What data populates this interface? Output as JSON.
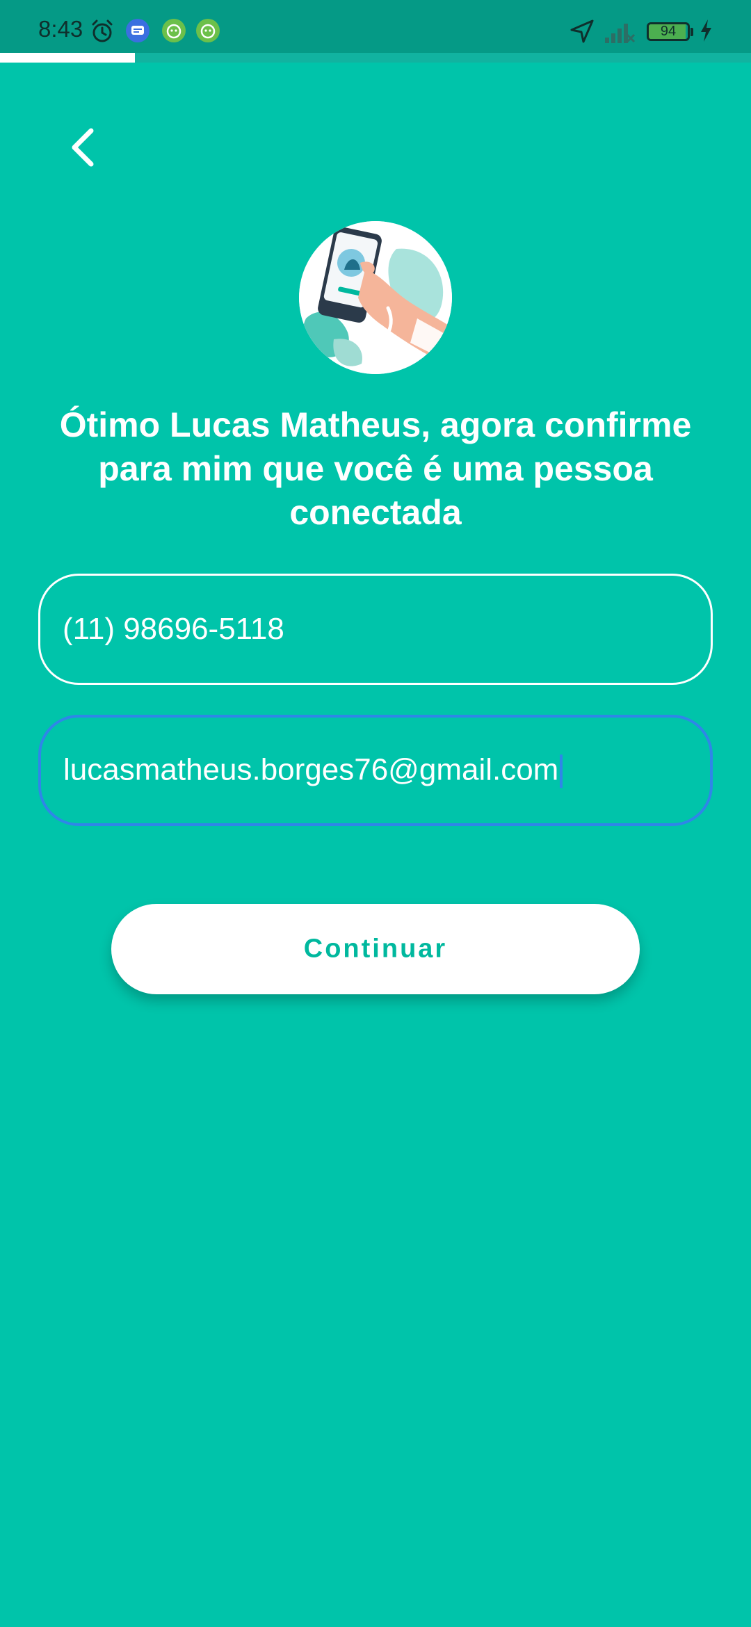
{
  "status_bar": {
    "time": "8:43",
    "battery_level": "94",
    "battery_fraction": 0.94,
    "icons": [
      "alarm-icon",
      "messages-icon",
      "app-icon",
      "app-icon",
      "location-arrow-icon",
      "signal-icon",
      "battery-icon",
      "charging-icon"
    ]
  },
  "progress": {
    "fraction": 0.18
  },
  "header": {
    "back_icon": "chevron-left-icon"
  },
  "content": {
    "headline": "Ótimo Lucas Matheus, agora confirme para mim que você é uma pessoa conectada",
    "phone_value": "(11) 98696-5118",
    "email_value": "lucasmatheus.borges76@gmail.com",
    "continue_label": "Continuar"
  },
  "colors": {
    "background": "#00c4aa",
    "accent": "#00b89e",
    "focus_border": "#2f86e8",
    "status_bar": "#059a86"
  }
}
